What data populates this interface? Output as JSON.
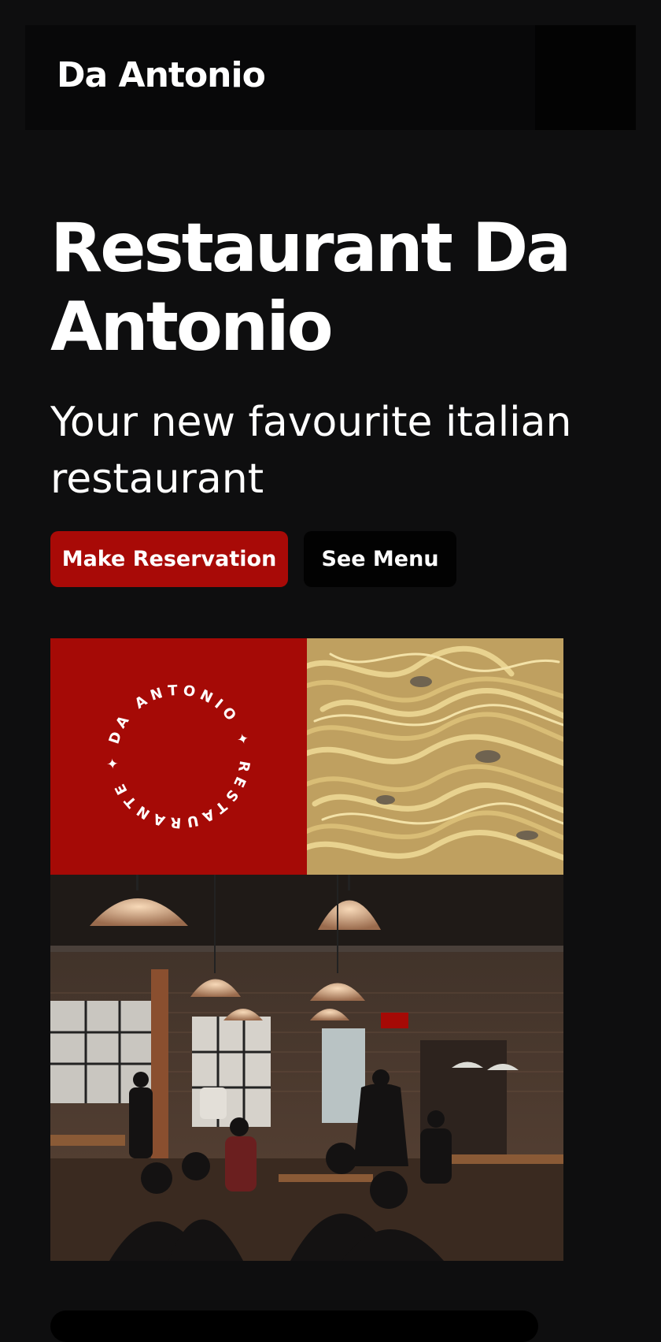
{
  "header": {
    "brand": "Da Antonio",
    "menu_icon": "menu-icon"
  },
  "hero": {
    "title": "Restaurant Da Antonio",
    "subtitle": "Your new favourite italian restaurant",
    "primary_button": "Make Reservation",
    "secondary_button": "See Menu"
  },
  "gallery": {
    "logo_text": "DA ANTONIO ✦ RESTAURANTE ✦",
    "tiles": [
      "logo-badge",
      "pasta-photo",
      "restaurant-interior-photo"
    ]
  },
  "colors": {
    "background": "#0e0e0f",
    "header": "#080809",
    "accent": "#a80a07",
    "secondary_button": "#020202",
    "text": "#ffffff"
  }
}
